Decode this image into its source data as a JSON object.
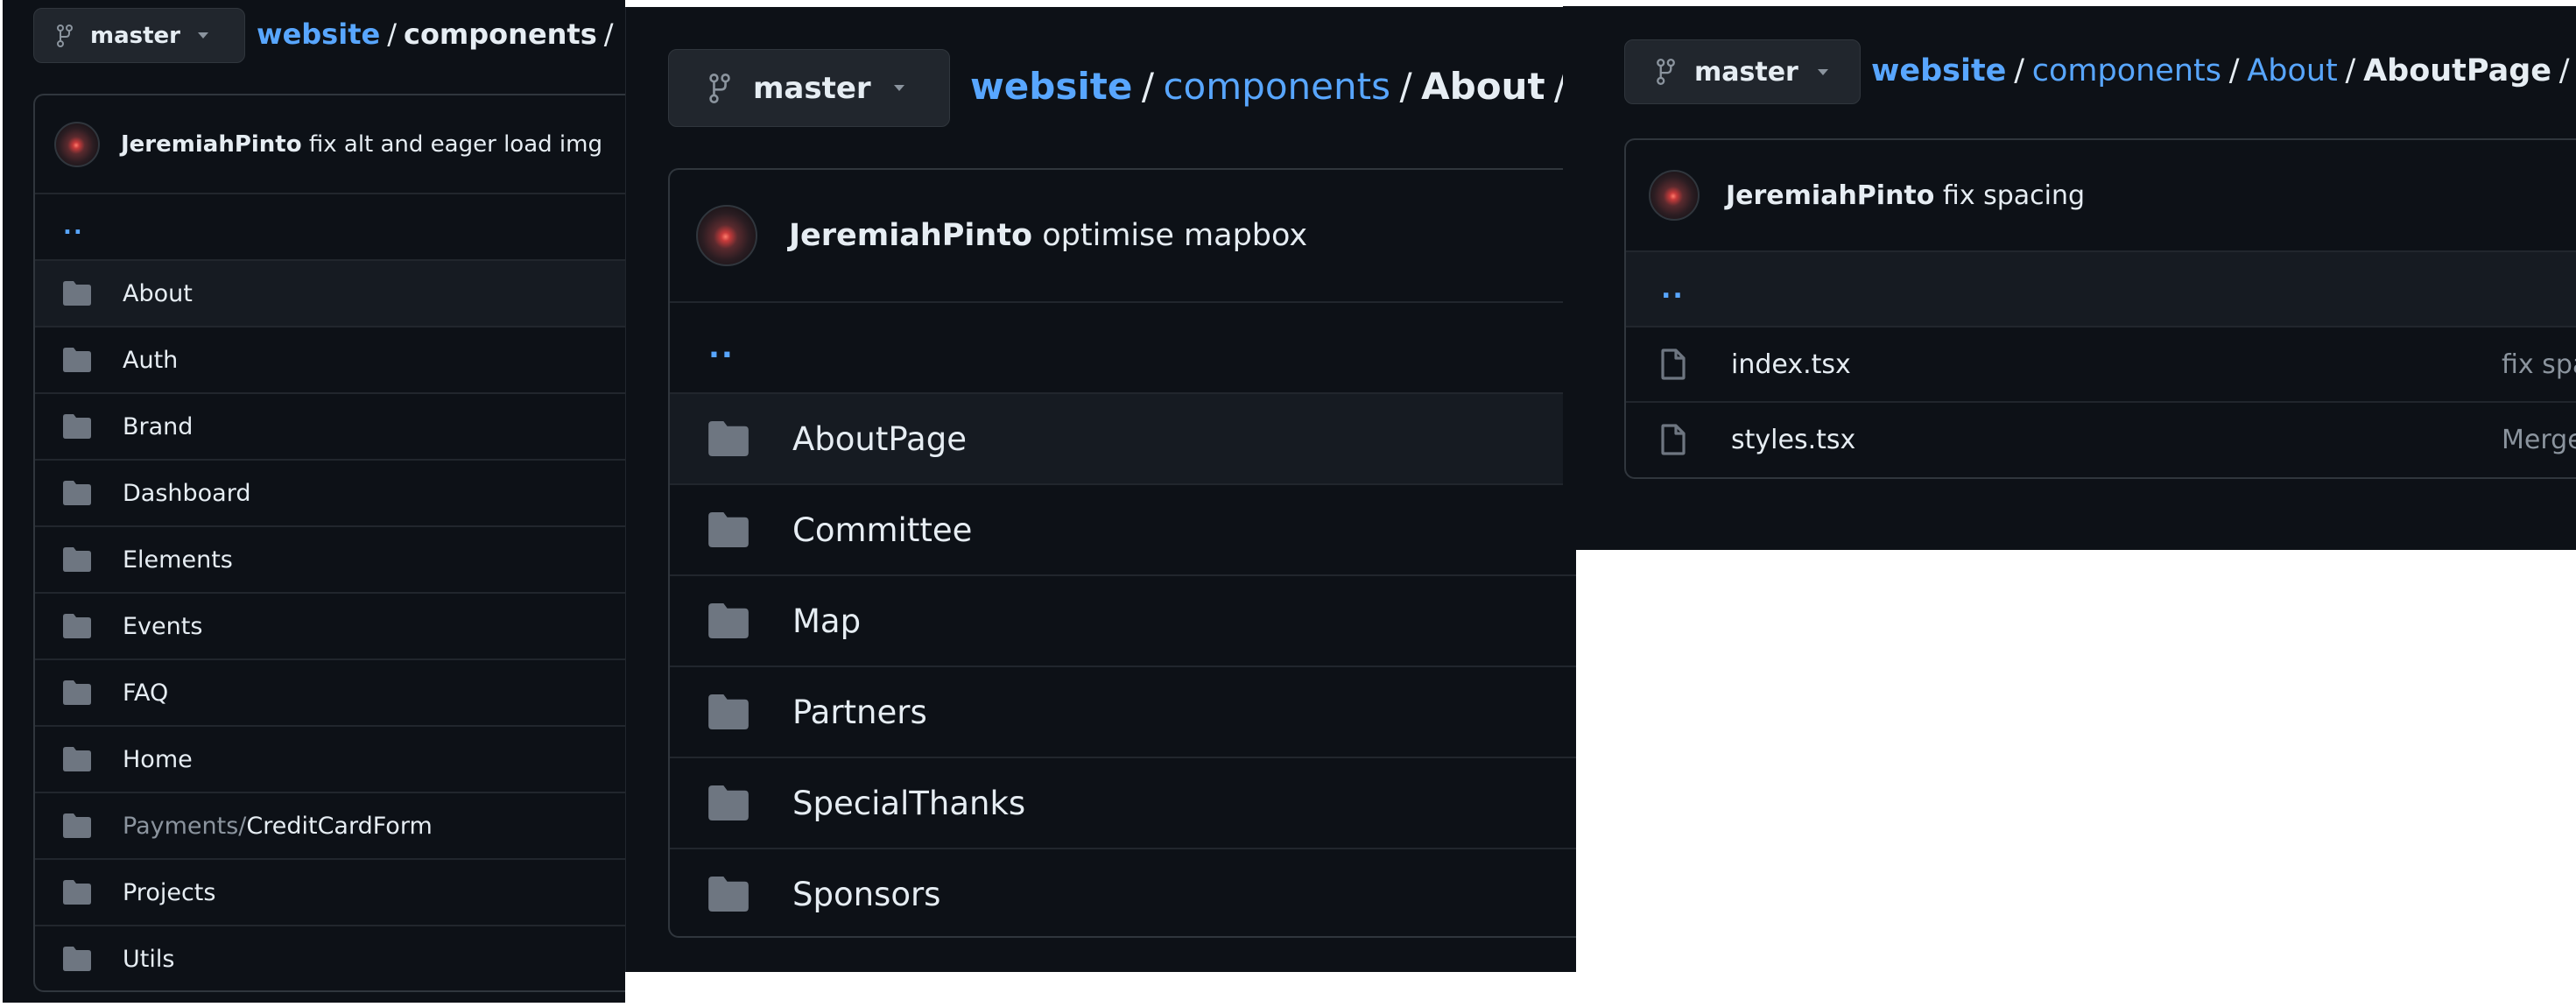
{
  "colors": {
    "background": "#0d1117",
    "link": "#58a6ff",
    "text": "#e6edf3",
    "muted": "#8b949e",
    "border": "#30363d",
    "row_highlight": "#161b22",
    "icon": "#6e7681"
  },
  "panels": [
    {
      "branch": {
        "label": "master",
        "icon": "git-branch-icon",
        "dropdown_icon": "caret-down-icon"
      },
      "breadcrumb": {
        "root": "website",
        "links": [],
        "current": "components",
        "separator": "/"
      },
      "latest_commit": {
        "author": "JeremiahPinto",
        "message": "fix alt and eager load img"
      },
      "parent_dir": "..",
      "items": [
        {
          "type": "folder",
          "name": "About",
          "highlighted": true
        },
        {
          "type": "folder",
          "name": "Auth"
        },
        {
          "type": "folder",
          "name": "Brand"
        },
        {
          "type": "folder",
          "name": "Dashboard"
        },
        {
          "type": "folder",
          "name": "Elements"
        },
        {
          "type": "folder",
          "name": "Events"
        },
        {
          "type": "folder",
          "name": "FAQ"
        },
        {
          "type": "folder",
          "name": "Home"
        },
        {
          "type": "folder",
          "name_prefix": "Payments/",
          "name": "CreditCardForm"
        },
        {
          "type": "folder",
          "name": "Projects"
        },
        {
          "type": "folder",
          "name": "Utils"
        }
      ]
    },
    {
      "branch": {
        "label": "master",
        "icon": "git-branch-icon",
        "dropdown_icon": "caret-down-icon"
      },
      "breadcrumb": {
        "root": "website",
        "links": [
          "components"
        ],
        "current": "About",
        "separator": "/"
      },
      "latest_commit": {
        "author": "JeremiahPinto",
        "message": "optimise mapbox"
      },
      "parent_dir": "..",
      "items": [
        {
          "type": "folder",
          "name": "AboutPage",
          "highlighted": true
        },
        {
          "type": "folder",
          "name": "Committee"
        },
        {
          "type": "folder",
          "name": "Map"
        },
        {
          "type": "folder",
          "name": "Partners"
        },
        {
          "type": "folder",
          "name": "SpecialThanks"
        },
        {
          "type": "folder",
          "name": "Sponsors"
        }
      ]
    },
    {
      "branch": {
        "label": "master",
        "icon": "git-branch-icon",
        "dropdown_icon": "caret-down-icon"
      },
      "breadcrumb": {
        "root": "website",
        "links": [
          "components",
          "About"
        ],
        "current": "AboutPage",
        "separator": "/"
      },
      "latest_commit": {
        "author": "JeremiahPinto",
        "message": "fix spacing"
      },
      "parent_dir": "..",
      "parent_highlighted": true,
      "items": [
        {
          "type": "file",
          "name": "index.tsx",
          "commit": "fix spa"
        },
        {
          "type": "file",
          "name": "styles.tsx",
          "commit": "Merge"
        }
      ]
    }
  ]
}
